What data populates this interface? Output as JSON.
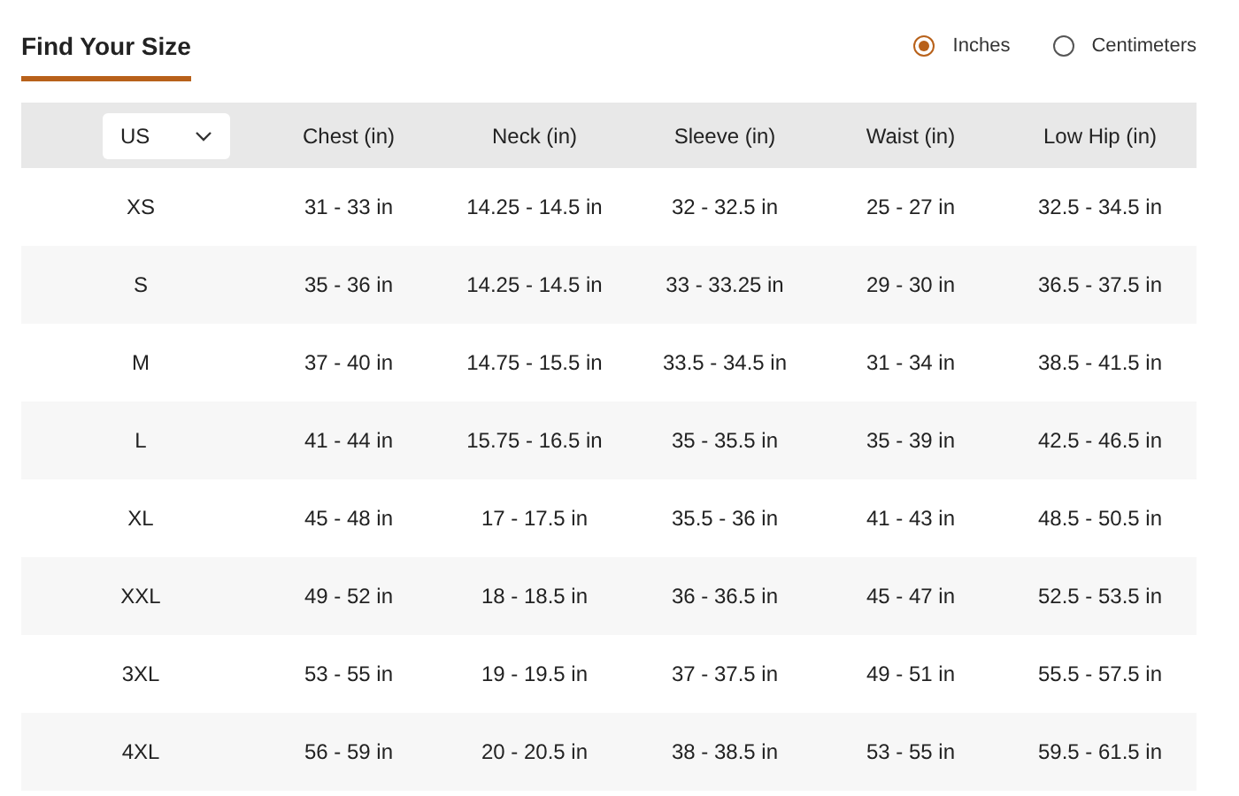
{
  "title": "Find Your Size",
  "units": [
    {
      "label": "Inches",
      "selected": true
    },
    {
      "label": "Centimeters",
      "selected": false
    }
  ],
  "table": {
    "columns": [
      "US",
      "Chest (in)",
      "Neck (in)",
      "Sleeve (in)",
      "Waist (in)",
      "Low Hip (in)"
    ],
    "rows": [
      [
        "XS",
        "31 - 33 in",
        "14.25 - 14.5 in",
        "32 - 32.5 in",
        "25 - 27 in",
        "32.5 - 34.5 in"
      ],
      [
        "S",
        "35 - 36 in",
        "14.25 - 14.5 in",
        "33 - 33.25 in",
        "29 - 30 in",
        "36.5 - 37.5 in"
      ],
      [
        "M",
        "37 - 40 in",
        "14.75 - 15.5 in",
        "33.5 - 34.5 in",
        "31 - 34 in",
        "38.5 - 41.5 in"
      ],
      [
        "L",
        "41 - 44 in",
        "15.75 - 16.5 in",
        "35 - 35.5 in",
        "35 - 39 in",
        "42.5 - 46.5 in"
      ],
      [
        "XL",
        "45 - 48 in",
        "17 - 17.5 in",
        "35.5 - 36 in",
        "41 - 43 in",
        "48.5 - 50.5 in"
      ],
      [
        "XXL",
        "49 - 52 in",
        "18 - 18.5 in",
        "36 - 36.5 in",
        "45 - 47 in",
        "52.5 - 53.5 in"
      ],
      [
        "3XL",
        "53 - 55 in",
        "19 - 19.5 in",
        "37 - 37.5 in",
        "49 - 51 in",
        "55.5 - 57.5 in"
      ],
      [
        "4XL",
        "56 - 59 in",
        "20 - 20.5 in",
        "38 - 38.5 in",
        "53 - 55 in",
        "59.5 - 61.5 in"
      ]
    ]
  }
}
